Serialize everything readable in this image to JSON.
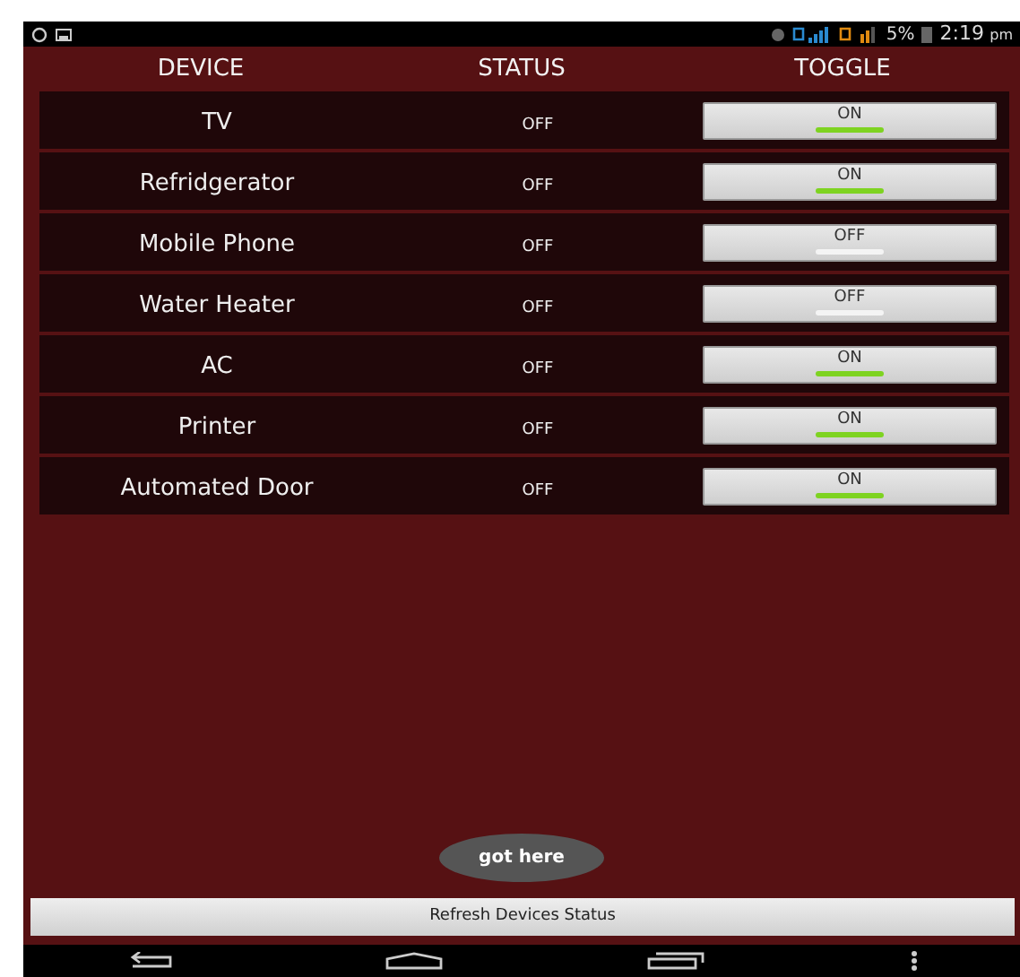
{
  "status_bar": {
    "battery": "5%",
    "time": "2:19",
    "ampm": "pm"
  },
  "columns": [
    "DEVICE",
    "STATUS",
    "TOGGLE"
  ],
  "devices": [
    {
      "name": "TV",
      "status": "OFF",
      "toggle": "ON",
      "on": true
    },
    {
      "name": "Refridgerator",
      "status": "OFF",
      "toggle": "ON",
      "on": true
    },
    {
      "name": "Mobile Phone",
      "status": "OFF",
      "toggle": "OFF",
      "on": false
    },
    {
      "name": "Water Heater",
      "status": "OFF",
      "toggle": "OFF",
      "on": false
    },
    {
      "name": "AC",
      "status": "OFF",
      "toggle": "ON",
      "on": true
    },
    {
      "name": "Printer",
      "status": "OFF",
      "toggle": "ON",
      "on": true
    },
    {
      "name": "Automated Door",
      "status": "OFF",
      "toggle": "ON",
      "on": true
    }
  ],
  "toast": "got here",
  "refresh_button": "Refresh Devices Status"
}
